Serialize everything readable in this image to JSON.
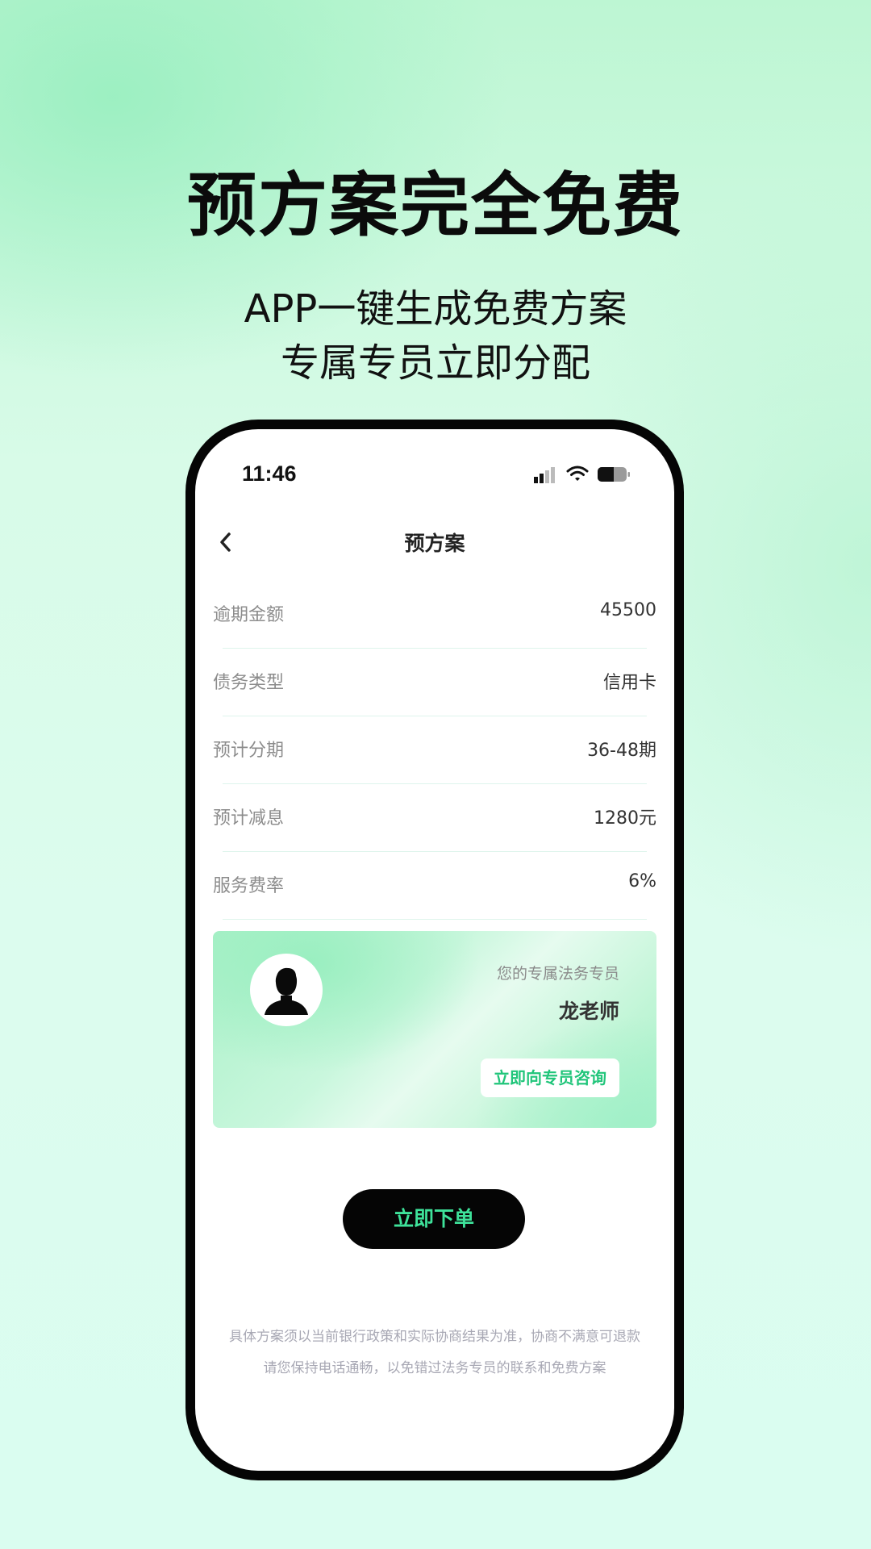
{
  "promo": {
    "headline": "预方案完全免费",
    "subline_1": "APP一键生成免费方案",
    "subline_2": "专属专员立即分配"
  },
  "status_bar": {
    "time": "11:46",
    "icons": [
      "cellular-signal-icon",
      "wifi-icon",
      "battery-icon"
    ]
  },
  "nav": {
    "title": "预方案",
    "back_icon": "chevron-left-icon"
  },
  "plan": {
    "rows": [
      {
        "label": "逾期金额",
        "value": "45500"
      },
      {
        "label": "债务类型",
        "value": "信用卡"
      },
      {
        "label": "预计分期",
        "value": "36-48期"
      },
      {
        "label": "预计减息",
        "value": "1280元"
      },
      {
        "label": "服务费率",
        "value": "6%"
      }
    ]
  },
  "advisor": {
    "caption": "您的专属法务专员",
    "name": "龙老师",
    "consult_label": "立即向专员咨询",
    "avatar_icon": "user-silhouette-icon"
  },
  "order": {
    "label": "立即下单"
  },
  "disclaimer": {
    "line_1": "具体方案须以当前银行政策和实际协商结果为准，协商不满意可退款",
    "line_2": "请您保持电话通畅，以免错过法务专员的联系和免费方案"
  },
  "colors": {
    "accent_green": "#3ee29a",
    "consult_green": "#20c57a",
    "button_black": "#050505"
  }
}
